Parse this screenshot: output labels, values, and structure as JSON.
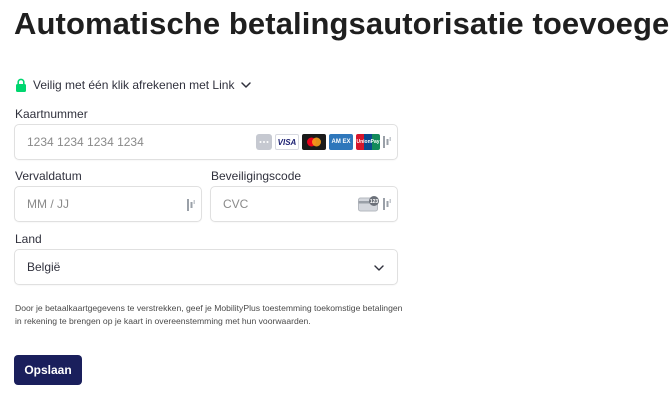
{
  "page": {
    "title": "Automatische betalingsautorisatie toevoegen"
  },
  "link": {
    "label": "Veilig met één klik afrekenen met Link",
    "accent_color": "#00d66f"
  },
  "card_number": {
    "label": "Kaartnummer",
    "placeholder": "1234 1234 1234 1234",
    "brands": [
      "generic-card-icon",
      "visa-icon",
      "mastercard-icon",
      "amex-icon",
      "unionpay-icon"
    ],
    "visa_text": "VISA",
    "amex_text": "AM EX",
    "unionpay_text": "UnionPay"
  },
  "expiry": {
    "label": "Vervaldatum",
    "placeholder": "MM / JJ"
  },
  "cvc": {
    "label": "Beveiligingscode",
    "placeholder": "CVC",
    "icon_text": "123"
  },
  "country": {
    "label": "Land",
    "value": "België"
  },
  "legal": {
    "text": "Door je betaalkaartgegevens te verstrekken, geef je MobilityPlus toestemming toekomstige betalingen in rekening te brengen op je kaart in overeenstemming met hun voorwaarden."
  },
  "actions": {
    "save_label": "Opslaan",
    "save_color": "#1a1f5c"
  }
}
